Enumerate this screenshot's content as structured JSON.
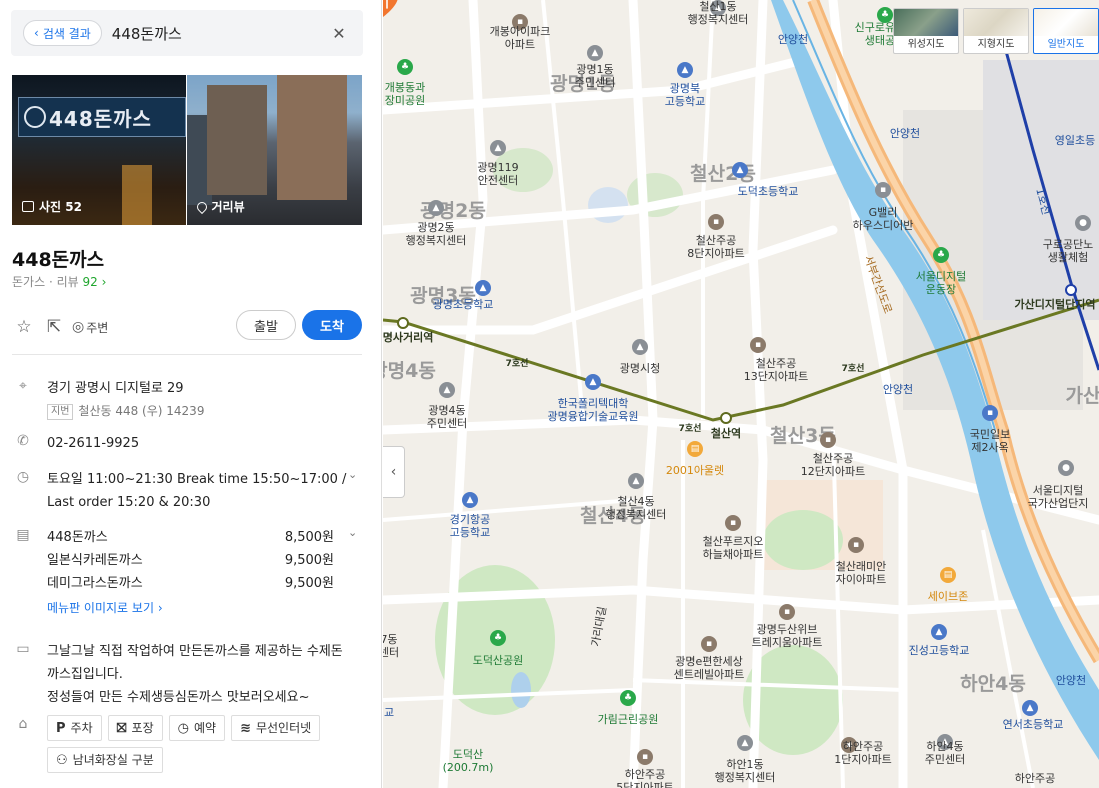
{
  "search": {
    "back_label": "검색 결과",
    "query": "448돈까스"
  },
  "photos": {
    "sign_text": "448돈까스",
    "photo_label": "사진 52",
    "street_label": "거리뷰"
  },
  "place": {
    "name": "448돈까스",
    "category": "돈가스",
    "review_prefix": "· 리뷰",
    "review_count": "92",
    "near_label": "주변",
    "depart_label": "출발",
    "arrive_label": "도착"
  },
  "address": {
    "road": "경기 광명시 디지털로 29",
    "jibun_tag": "지번",
    "jibun": "철산동 448 (우) 14239"
  },
  "phone": "02-2611-9925",
  "hours": {
    "line1": "토요일 11:00~21:30 Break time 15:50~17:00 /",
    "line2": "Last order 15:20 & 20:30"
  },
  "menu": {
    "items": [
      {
        "name": "448돈까스",
        "price": "8,500원"
      },
      {
        "name": "일본식카레돈까스",
        "price": "9,500원"
      },
      {
        "name": "데미그라스돈까스",
        "price": "9,500원"
      }
    ],
    "link": "메뉴판 이미지로 보기"
  },
  "description": {
    "line1": "그날그날 직접 작업하여 만든돈까스를 제공하는 수제돈",
    "line2": "까스집입니다.",
    "line3": "정성들여 만든 수제생등심돈까스 맛보러오세요~"
  },
  "amenities": [
    "주차",
    "포장",
    "예약",
    "무선인터넷",
    "남녀화장실 구분"
  ],
  "map": {
    "types": [
      "위성지도",
      "지형지도",
      "일반지도"
    ],
    "dong_labels": [
      "광명1동",
      "철산2동",
      "광명2동",
      "광명3동",
      "광명4동",
      "철산3동",
      "철산4동",
      "하안4동",
      "가산"
    ],
    "labels": [
      {
        "t": "철산1동\n행정복지센터",
        "c": ""
      },
      {
        "t": "개봉아이파크\n아파트",
        "c": ""
      },
      {
        "t": "광명1동\n주민센터",
        "c": ""
      },
      {
        "t": "광명북\n고등학교",
        "c": "blue"
      },
      {
        "t": "개봉동과\n장미공원",
        "c": "green"
      },
      {
        "t": "광명119\n안전센터",
        "c": ""
      },
      {
        "t": "도덕초등학교",
        "c": "blue"
      },
      {
        "t": "철산주공\n8단지아파트",
        "c": ""
      },
      {
        "t": "광명2동\n행정복지센터",
        "c": ""
      },
      {
        "t": "광명초등학교",
        "c": "blue"
      },
      {
        "t": "광명사거리역",
        "c": "dark"
      },
      {
        "t": "광명시청",
        "c": ""
      },
      {
        "t": "철산주공\n13단지아파트",
        "c": ""
      },
      {
        "t": "한국폴리텍대학\n광명융합기술교육원",
        "c": "blue"
      },
      {
        "t": "광명4동\n주민센터",
        "c": ""
      },
      {
        "t": "철산역",
        "c": "dark"
      },
      {
        "t": "2001아울렛",
        "c": "orange"
      },
      {
        "t": "철산주공\n12단지아파트",
        "c": ""
      },
      {
        "t": "철산4동\n행정복지센터",
        "c": ""
      },
      {
        "t": "경기항공\n고등학교",
        "c": "blue"
      },
      {
        "t": "철산푸르지오\n하늘채아파트",
        "c": ""
      },
      {
        "t": "철산래미안\n자이아파트",
        "c": ""
      },
      {
        "t": "세이브존",
        "c": "orange"
      },
      {
        "t": "도덕산공원",
        "c": "green"
      },
      {
        "t": "광명두산위브\n트레지움아파트",
        "c": ""
      },
      {
        "t": "광명e편한세상\n센트레빌아파트",
        "c": ""
      },
      {
        "t": "진성고등학교",
        "c": "blue"
      },
      {
        "t": "가림근린공원",
        "c": "green"
      },
      {
        "t": "도덕산\n(200.7m)",
        "c": "green"
      },
      {
        "t": "하안주공\n5단지아파트",
        "c": ""
      },
      {
        "t": "하안1동\n행정복지센터",
        "c": ""
      },
      {
        "t": "하안주공\n1단지아파트",
        "c": ""
      },
      {
        "t": "하안4동\n주민센터",
        "c": ""
      },
      {
        "t": "연서초등학교",
        "c": "blue"
      },
      {
        "t": "하안주공",
        "c": ""
      },
      {
        "t": "신구로유수지\n생태공원",
        "c": "green"
      },
      {
        "t": "G밸리\n하우스디어반",
        "c": ""
      },
      {
        "t": "서울디지털\n운동장",
        "c": "green"
      },
      {
        "t": "국민일보\n제2사옥",
        "c": ""
      },
      {
        "t": "서울디지털\n국가산업단지",
        "c": ""
      },
      {
        "t": "가산디지털단지역",
        "c": "dark"
      },
      {
        "t": "구로공단노\n생활체험",
        "c": ""
      },
      {
        "t": "영일초등",
        "c": "blue"
      },
      {
        "t": "안양천",
        "c": "blue"
      },
      {
        "t": "안양천",
        "c": "blue"
      },
      {
        "t": "안양천",
        "c": "blue"
      },
      {
        "t": "안양천",
        "c": "blue"
      },
      {
        "t": "서부간선도로",
        "c": "road"
      },
      {
        "t": "7호선",
        "c": "dark"
      },
      {
        "t": "7호선",
        "c": "dark"
      },
      {
        "t": "7호선",
        "c": "dark"
      },
      {
        "t": "가리대길",
        "c": ""
      },
      {
        "t": "1호선",
        "c": "blue"
      },
      {
        "t": "7동\n센터",
        "c": ""
      },
      {
        "t": "교",
        "c": "blue"
      }
    ]
  }
}
